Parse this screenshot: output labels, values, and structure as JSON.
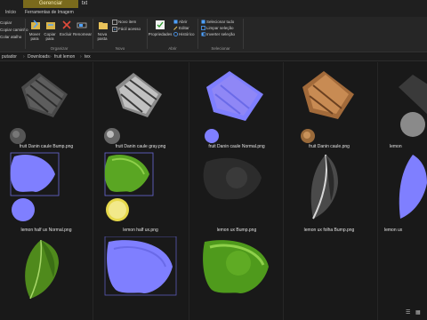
{
  "titlebar": {
    "manage_tab": "Gerenciar",
    "txt_tab": "txt"
  },
  "ribbon_tabs": [
    "Início",
    "Ferramentas de Imagem"
  ],
  "ribbon": {
    "clipboard_partial": [
      "Copiar",
      "Copiar caminho",
      "Colar atalho"
    ],
    "organize": {
      "move_to": "Mover para",
      "copy_to": "Copiar para",
      "delete": "Excluir",
      "rename": "Renomear",
      "label": "Organizar"
    },
    "new": {
      "new_folder": "Nova pasta",
      "new_item": "Novo item",
      "easy_access": "Fácil acesso",
      "label": "Novo"
    },
    "open": {
      "properties": "Propriedades",
      "open": "Abrir",
      "edit": "Editar",
      "history": "Histórico",
      "label": "Abrir"
    },
    "select": {
      "select_all": "Selecionar tudo",
      "select_none": "Limpar seleção",
      "invert": "Inverter seleção",
      "label": "Selecionar"
    }
  },
  "breadcrumb": [
    "putador",
    "Downloads",
    "fruit lemon",
    "tex"
  ],
  "files": [
    {
      "name": "fruit Danin caule Bump.png",
      "texture": "bump-stem"
    },
    {
      "name": "fruit Danin caule gray.png",
      "texture": "gray-stem"
    },
    {
      "name": "fruit Danin caule Normal.png",
      "texture": "normal-stem"
    },
    {
      "name": "fruit Danin caule.png",
      "texture": "color-stem"
    },
    {
      "name": "lemon",
      "texture": "partial"
    },
    {
      "name": "lemon half ux Normal.png",
      "texture": "normal-half"
    },
    {
      "name": "lemon half ux.png",
      "texture": "color-half"
    },
    {
      "name": "lemon ux Bump.png",
      "texture": "bump-lemon"
    },
    {
      "name": "lemon ux folha Bump.png",
      "texture": "bump-leaf"
    },
    {
      "name": "lemon ux",
      "texture": "partial-normal"
    },
    {
      "name": "",
      "texture": "leaf-green"
    },
    {
      "name": "",
      "texture": "normal-lemon"
    },
    {
      "name": "",
      "texture": "color-lemon"
    }
  ],
  "colors": {
    "normal_blue": "#7f7fff",
    "lemon_green": "#5aa623",
    "accent": "#7a6a1c"
  }
}
